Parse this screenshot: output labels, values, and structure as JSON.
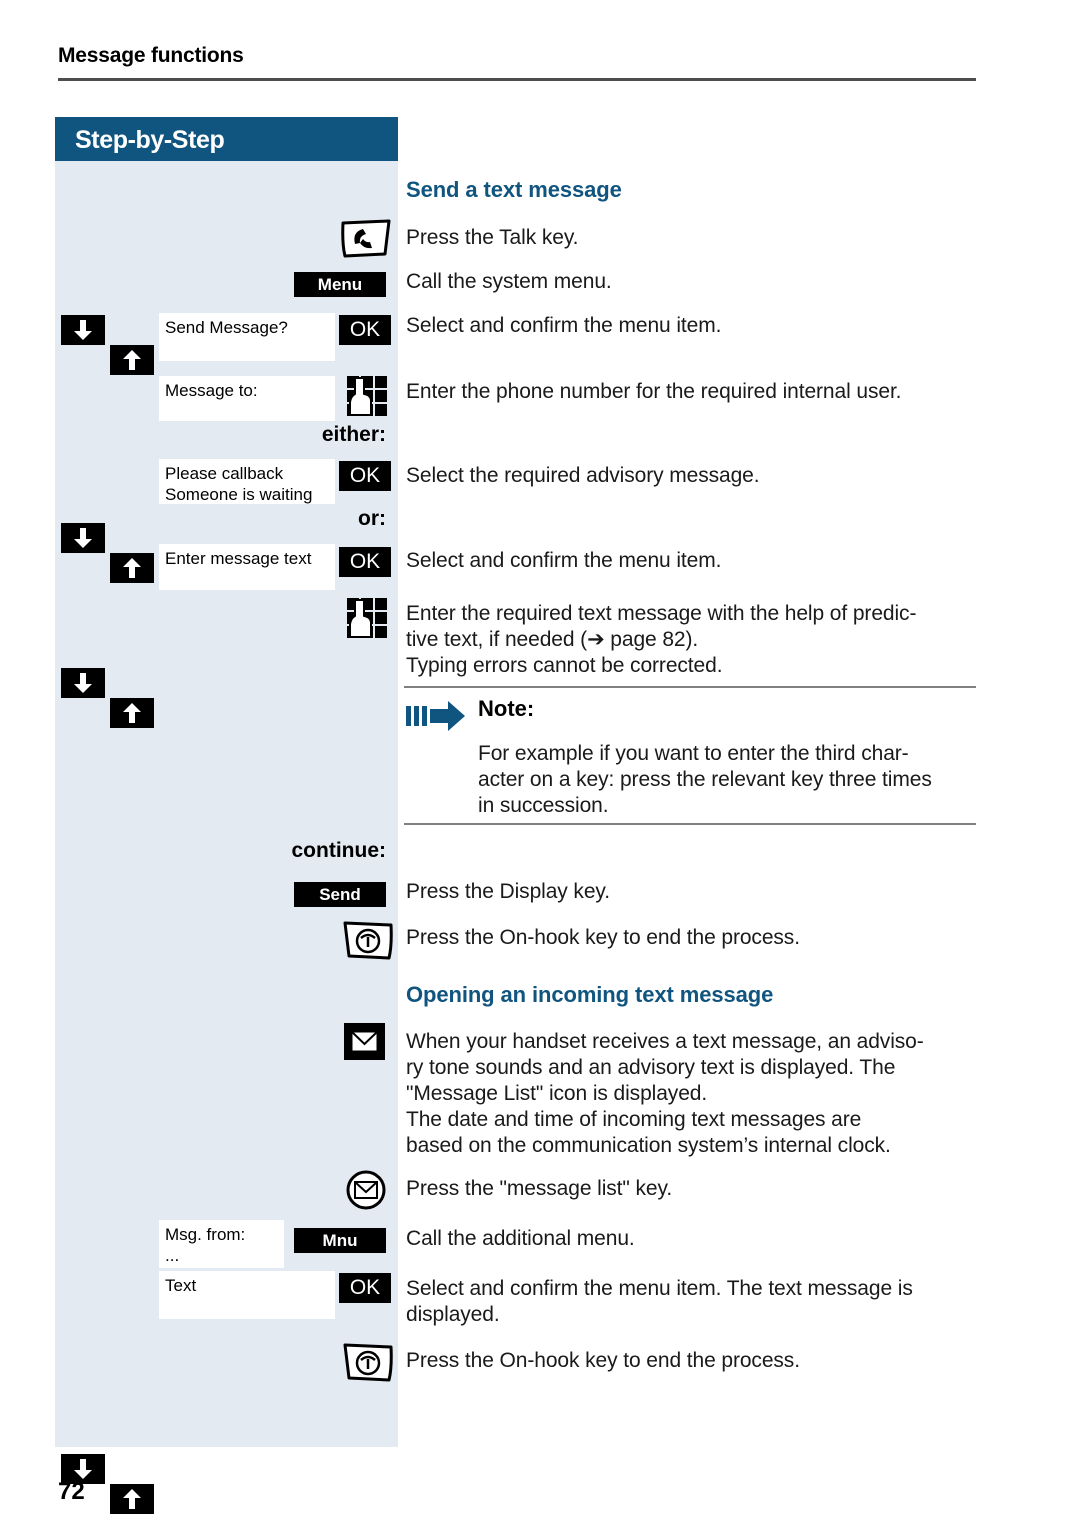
{
  "page": {
    "running_head": "Message functions",
    "number": "72"
  },
  "sidebar": {
    "title": "Step-by-Step",
    "markers": {
      "either": "either:",
      "or": "or:",
      "continue": "continue:"
    },
    "keys": {
      "menu_softkey": "Menu",
      "send_softkey": "Send",
      "mnu_softkey": "Mnu",
      "ok": "OK"
    },
    "displays": {
      "send_message": "Send Message?",
      "message_to": "Message to:",
      "advisory_line1": "Please callback",
      "advisory_line2": "Someone is waiting",
      "enter_message_text": "Enter message text",
      "msg_from_line1": "Msg. from:",
      "msg_from_line2": "...",
      "text_item": "Text"
    },
    "icons": {
      "talk_key": "talk-key-icon",
      "on_hook_key": "on-hook-key-icon",
      "keypad": "keypad-entry-icon",
      "message_envelope": "message-envelope-icon",
      "message_list_key": "message-list-key-icon",
      "arrow_down": "arrow-down-icon",
      "arrow_up": "arrow-up-icon"
    }
  },
  "content": {
    "heading_send": "Send a text message",
    "heading_opening": "Opening an incoming text message",
    "steps": {
      "press_talk": "Press the Talk key.",
      "call_system_menu": "Call the system menu.",
      "select_confirm_1": "Select and confirm the menu item.",
      "enter_phone_number": "Enter the phone number for the required internal user.",
      "select_advisory": "Select the required advisory message.",
      "select_confirm_2": "Select and confirm the menu item.",
      "enter_text_line1": "Enter the required text message with the help of predic-",
      "enter_text_line2": "tive text, if needed (➔ page 82).",
      "enter_text_line3": "Typing errors cannot be corrected.",
      "press_display_key": "Press the Display key.",
      "press_onhook_1": "Press the On-hook key to end the process.",
      "incoming_line1": "When your handset receives a text message, an adviso-",
      "incoming_line2": "ry tone sounds and an advisory text is displayed. The",
      "incoming_line3": "\"Message List\" icon is displayed.",
      "incoming_line4": "The date and time of incoming text messages are",
      "incoming_line5": "based on the communication system’s internal clock.",
      "press_message_list": "Press the \"message list\" key.",
      "call_additional_menu": "Call the additional menu.",
      "select_confirm_3_line1": "Select and confirm the menu item. The text message is",
      "select_confirm_3_line2": "displayed.",
      "press_onhook_2": "Press the On-hook key to end the process."
    },
    "note": {
      "title": "Note:",
      "line1": "For example  if you want to enter the third char-",
      "line2": "acter on a key: press the relevant key three times",
      "line3": "in succession.",
      "icon": "note-arrow-icon"
    }
  },
  "colors": {
    "brand_blue": "#10557f",
    "sidebar_bg": "#e3eaf1",
    "rule_grey": "#4d4d4d"
  }
}
